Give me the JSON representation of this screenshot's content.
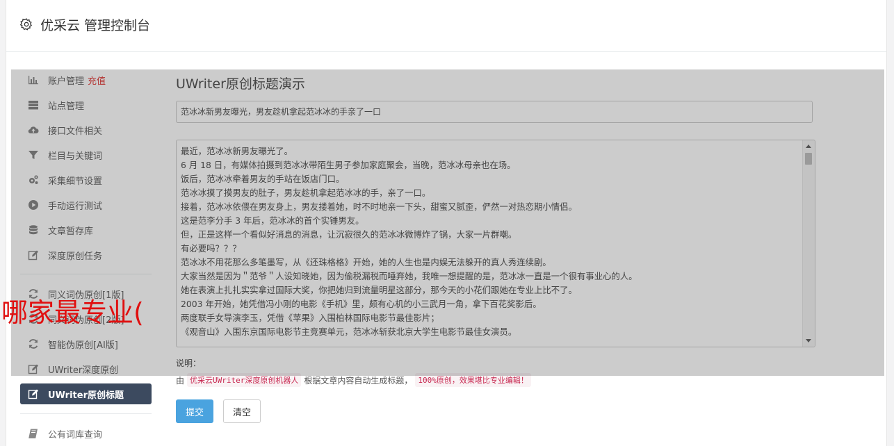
{
  "header": {
    "title": "优采云 管理控制台"
  },
  "sidebar": {
    "items": [
      {
        "label": "账户管理",
        "badge": "充值",
        "icon": "bar-chart-icon"
      },
      {
        "label": "站点管理",
        "icon": "server-icon"
      },
      {
        "label": "接口文件相关",
        "icon": "cloud-upload-icon"
      },
      {
        "label": "栏目与关键词",
        "icon": "filter-icon"
      },
      {
        "label": "采集细节设置",
        "icon": "cogs-icon"
      },
      {
        "label": "手动运行测试",
        "icon": "play-circle-icon"
      },
      {
        "label": "文章暂存库",
        "icon": "database-icon"
      },
      {
        "label": "深度原创任务",
        "icon": "edit-icon"
      },
      {
        "label": "同义词伪原创[1版]",
        "icon": "refresh-icon"
      },
      {
        "label": "同义词伪原创[2版]",
        "icon": "refresh-icon"
      },
      {
        "label": "智能伪原创[AI版]",
        "icon": "refresh-icon"
      },
      {
        "label": "UWriter深度原创",
        "icon": "edit-icon"
      },
      {
        "label": "UWriter原创标题",
        "icon": "edit-icon",
        "active": true
      },
      {
        "label": "公有词库查询",
        "icon": "book-icon"
      }
    ]
  },
  "main": {
    "page_title": "UWriter原创标题演示",
    "title_value": "范冰冰新男友曝光，男友趁机拿起范冰冰的手亲了一口",
    "content_lines": [
      "最近，范冰冰新男友曝光了。",
      "6 月 18 日，有媒体拍摄到范冰冰带陌生男子参加家庭聚会，当晚，范冰冰母亲也在场。",
      "饭后，范冰冰牵着男友的手站在饭店门口。",
      "范冰冰摸了摸男友的肚子，男友趁机拿起范冰冰的手，亲了一口。",
      "接着，范冰冰依偎在男友身上，男友搂着她，时不时地亲一下头，甜蜜又腻歪，俨然一对热恋期小情侣。",
      "这是范李分手 3 年后，范冰冰的首个实锤男友。",
      "但，正是这样一个看似好消息的消息，让沉寂很久的范冰冰微博炸了锅，大家一片群嘲。",
      "有必要吗？？？",
      "范冰冰不用花那么多笔墨写，从《还珠格格》开始，她的人生也是内娱无法躲开的真人秀连续剧。",
      "大家当然是因为＂范爷＂人设知晓她，因为偷税漏税而唾弃她，我唯一想提醒的是，范冰冰一直是一个很有事业心的人。",
      "她在表演上扎扎实实拿过国际大奖，你把她归到流量明星这部分，那今天的小花们跟她在专业上比不了。",
      "2003 年开始，她凭借冯小刚的电影《手机》里，颇有心机的小三武月一角，拿下百花奖影后。",
      "两度联手女导演李玉，凭借《苹果》入围柏林国际电影节最佳影片；",
      "《观音山》入围东京国际电影节主竞赛单元，范冰冰斩获北京大学生电影节最佳女演员。"
    ],
    "explain_label": "说明：",
    "explain_prefix": "由",
    "explain_code1": "优采云UWriter深度原创机器人",
    "explain_mid": "根据文章内容自动生成标题，",
    "explain_code2": "100%原创，效果堪比专业编辑！",
    "submit_label": "提交",
    "clear_label": "清空"
  },
  "watermark": "哪家最专业(",
  "colors": {
    "accent": "#4aa3df",
    "active_nav": "#3c4a5f",
    "badge": "#e0413f"
  }
}
